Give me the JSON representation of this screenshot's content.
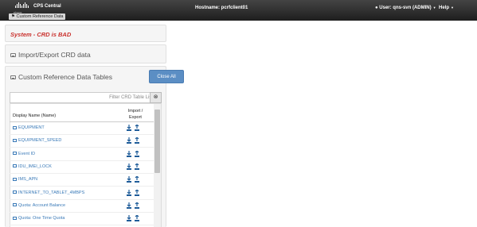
{
  "header": {
    "logo_text": "cisco",
    "app_title": "CPS Central",
    "breadcrumb": "Custom Reference Data",
    "hostname_label": "Hostname: pcrfclient01",
    "user_label": "User: qns-svn (ADMIN)",
    "help_label": "Help"
  },
  "panels": {
    "status_text": "System - CRD is BAD",
    "import_export_title": "Import/Export CRD data",
    "tables_title": "Custom Reference Data Tables",
    "close_all_label": "Close All"
  },
  "filter": {
    "placeholder": "Filter CRD Table List",
    "clear_icon": "circle-x-icon"
  },
  "table": {
    "col_name": "Display Name (Name)",
    "col_import_export": [
      "Import /",
      "Export"
    ],
    "rows": [
      "EQUIPMENT",
      "EQUIPMENT_SPEED",
      "Event ID",
      "IDU_IMEI_LOCK",
      "IMS_APN",
      "INTERNET_TO_TABLET_4MBPS",
      "Quota: Account Balance",
      "Quota: One Time Quota"
    ]
  },
  "colors": {
    "header_bg": "#1e1e1e",
    "status_red": "#c9302c",
    "link_blue": "#3a7ab8",
    "button_blue": "#5b8ec4"
  }
}
